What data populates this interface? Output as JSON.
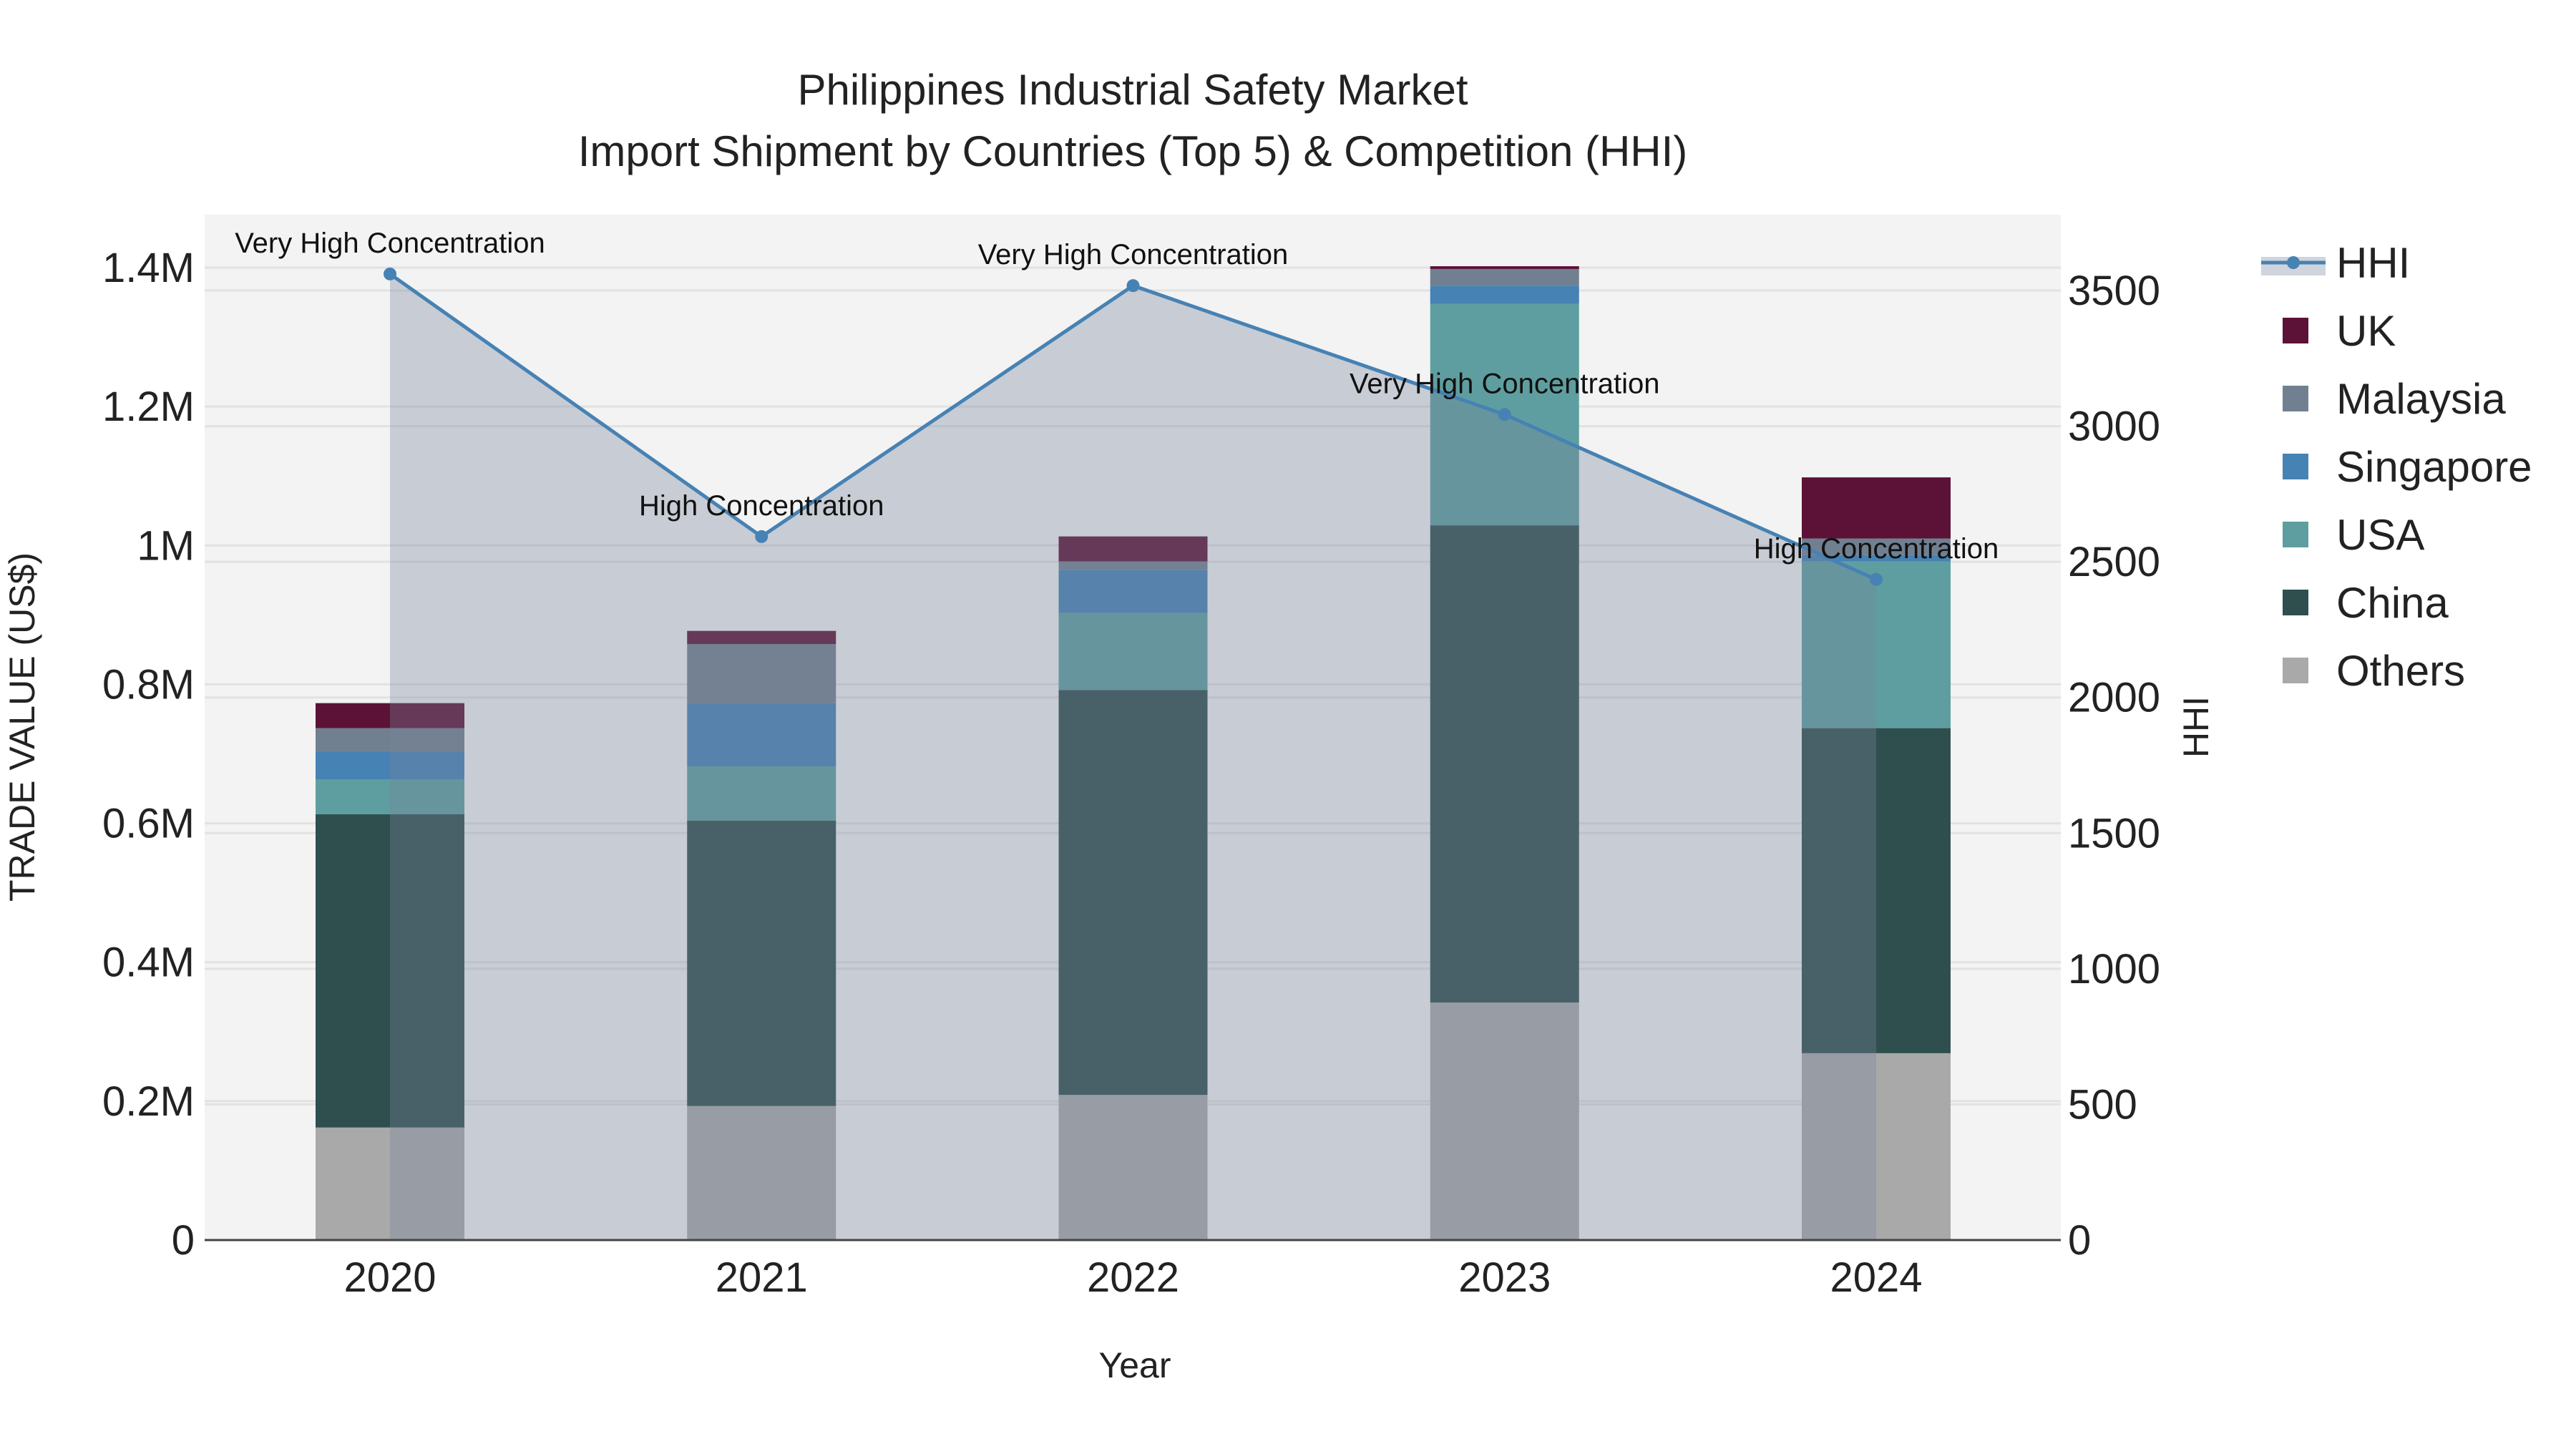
{
  "chart_data": {
    "type": "bar",
    "title": "Philippines Industrial Safety Market",
    "subtitle": "Import Shipment by Countries (Top 5) & Competition (HHI)",
    "xlabel": "Year",
    "ylabel": "TRADE VALUE (US$)",
    "y2label": "HHI",
    "categories": [
      "2020",
      "2021",
      "2022",
      "2023",
      "2024"
    ],
    "ylim": [
      0,
      1.475
    ],
    "y_unit": "million US$",
    "yticks": [
      {
        "v": 0,
        "label": "0"
      },
      {
        "v": 0.2,
        "label": "0.2M"
      },
      {
        "v": 0.4,
        "label": "0.4M"
      },
      {
        "v": 0.6,
        "label": "0.6M"
      },
      {
        "v": 0.8,
        "label": "0.8M"
      },
      {
        "v": 1.0,
        "label": "1M"
      },
      {
        "v": 1.2,
        "label": "1.2M"
      },
      {
        "v": 1.4,
        "label": "1.4M"
      }
    ],
    "y2lim": [
      0,
      3780
    ],
    "y2ticks": [
      0,
      500,
      1000,
      1500,
      2000,
      2500,
      3000,
      3500
    ],
    "barmode": "stack",
    "series": [
      {
        "name": "Others",
        "color": "#a9a9a9",
        "values": [
          0.162,
          0.193,
          0.209,
          0.342,
          0.269
        ]
      },
      {
        "name": "China",
        "color": "#2f4f4f",
        "values": [
          0.451,
          0.411,
          0.583,
          0.687,
          0.468
        ]
      },
      {
        "name": "USA",
        "color": "#5f9ea0",
        "values": [
          0.05,
          0.078,
          0.111,
          0.319,
          0.24
        ]
      },
      {
        "name": "Singapore",
        "color": "#4682b4",
        "values": [
          0.041,
          0.091,
          0.062,
          0.026,
          0.009
        ]
      },
      {
        "name": "Malaysia",
        "color": "#708090",
        "values": [
          0.033,
          0.085,
          0.012,
          0.024,
          0.024
        ]
      },
      {
        "name": "UK",
        "color": "#5c1236",
        "values": [
          0.036,
          0.019,
          0.036,
          0.004,
          0.088
        ]
      }
    ],
    "line": {
      "name": "HHI",
      "color": "#4682b4",
      "axis": "y2",
      "values": [
        3561,
        2593,
        3518,
        3043,
        2435
      ],
      "annotations": [
        "Very High Concentration",
        "High Concentration",
        "Very High Concentration",
        "Very High Concentration",
        "High Concentration"
      ]
    },
    "legend": {
      "placement": "right",
      "order": [
        "HHI",
        "UK",
        "Malaysia",
        "Singapore",
        "USA",
        "China",
        "Others"
      ]
    },
    "grid": true
  }
}
